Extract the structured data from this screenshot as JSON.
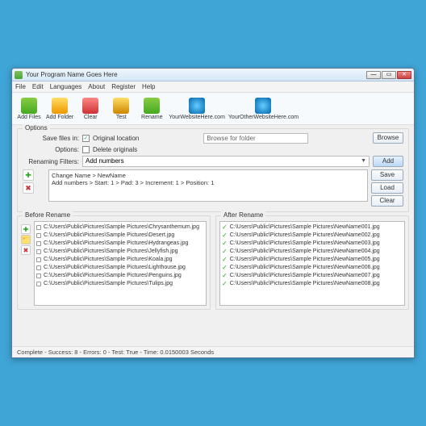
{
  "title": "Your Program Name Goes Here",
  "menu": [
    "File",
    "Edit",
    "Languages",
    "About",
    "Register",
    "Help"
  ],
  "toolbar": [
    {
      "label": "Add Files",
      "color": "linear-gradient(#8c4,#4a2)"
    },
    {
      "label": "Add Folder",
      "color": "linear-gradient(#fd6,#e90)"
    },
    {
      "label": "Clear",
      "color": "linear-gradient(#f88,#c33)"
    },
    {
      "label": "Test",
      "color": "linear-gradient(#fd6,#c80)"
    },
    {
      "label": "Rename",
      "color": "linear-gradient(#8c4,#4a2)"
    },
    {
      "label": "YourWebsiteHere.com",
      "color": "radial-gradient(circle,#6cf,#06a)"
    },
    {
      "label": "YourOtherWebsiteHere.com",
      "color": "radial-gradient(circle,#6cf,#06a)"
    }
  ],
  "options": {
    "group": "Options",
    "saveLabel": "Save files in:",
    "saveCheck": "Original location",
    "optLabel": "Options:",
    "optCheck": "Delete originals",
    "filtLabel": "Renaming Filters:",
    "filtValue": "Add numbers",
    "browsePlaceholder": "Browse for folder",
    "browseBtn": "Browse",
    "addBtn": "Add",
    "sideBtns": [
      "Save",
      "Load",
      "Clear"
    ],
    "filterLines": [
      "Change Name > NewName",
      "Add numbers > Start: 1 > Pad: 3 > Increment: 1 > Position: 1"
    ]
  },
  "before": {
    "label": "Before Rename",
    "items": [
      "C:\\Users\\Public\\Pictures\\Sample Pictures\\Chrysanthemum.jpg",
      "C:\\Users\\Public\\Pictures\\Sample Pictures\\Desert.jpg",
      "C:\\Users\\Public\\Pictures\\Sample Pictures\\Hydrangeas.jpg",
      "C:\\Users\\Public\\Pictures\\Sample Pictures\\Jellyfish.jpg",
      "C:\\Users\\Public\\Pictures\\Sample Pictures\\Koala.jpg",
      "C:\\Users\\Public\\Pictures\\Sample Pictures\\Lighthouse.jpg",
      "C:\\Users\\Public\\Pictures\\Sample Pictures\\Penguins.jpg",
      "C:\\Users\\Public\\Pictures\\Sample Pictures\\Tulips.jpg"
    ]
  },
  "after": {
    "label": "After Rename",
    "items": [
      "C:\\Users\\Public\\Pictures\\Sample Pictures\\NewName001.jpg",
      "C:\\Users\\Public\\Pictures\\Sample Pictures\\NewName002.jpg",
      "C:\\Users\\Public\\Pictures\\Sample Pictures\\NewName003.jpg",
      "C:\\Users\\Public\\Pictures\\Sample Pictures\\NewName004.jpg",
      "C:\\Users\\Public\\Pictures\\Sample Pictures\\NewName005.jpg",
      "C:\\Users\\Public\\Pictures\\Sample Pictures\\NewName006.jpg",
      "C:\\Users\\Public\\Pictures\\Sample Pictures\\NewName007.jpg",
      "C:\\Users\\Public\\Pictures\\Sample Pictures\\NewName008.jpg"
    ]
  },
  "status": "Complete - Success: 8 - Errors: 0 - Test: True - Time: 0.0150003 Seconds"
}
